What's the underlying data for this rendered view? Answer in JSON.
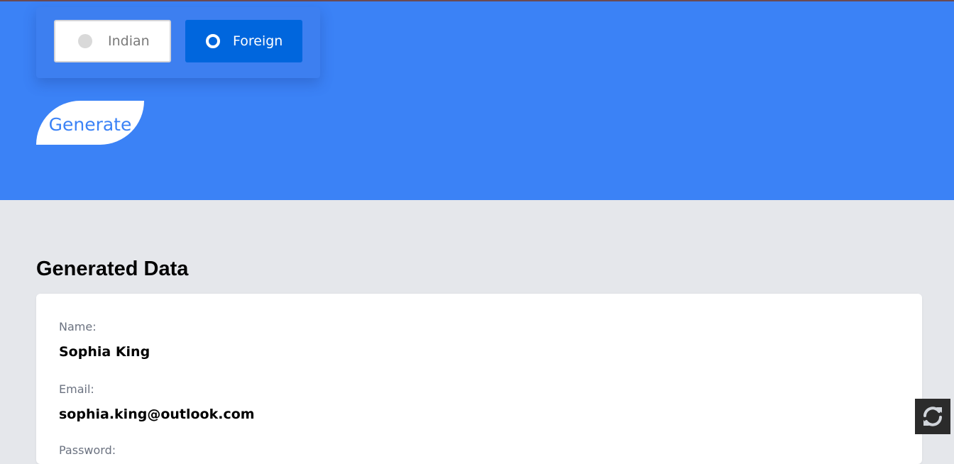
{
  "nationality_toggle": {
    "options": [
      {
        "label": "Indian",
        "selected": false
      },
      {
        "label": "Foreign",
        "selected": true
      }
    ]
  },
  "generate_button": {
    "label": "Generate"
  },
  "generated_data": {
    "title": "Generated Data",
    "fields": [
      {
        "label": "Name:",
        "value": "Sophia King"
      },
      {
        "label": "Email:",
        "value": "sophia.king@outlook.com"
      },
      {
        "label": "Password:",
        "value": ""
      }
    ]
  },
  "refresh_button": {
    "icon": "refresh-icon"
  },
  "colors": {
    "hero_background": "#3b82f6",
    "page_background": "#e5e7eb",
    "selected_option": "#0066dd",
    "refresh_button": "#2b2b2b"
  }
}
